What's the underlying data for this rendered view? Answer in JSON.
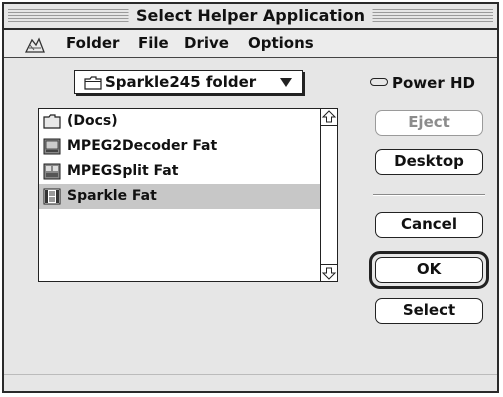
{
  "window": {
    "title": "Select Helper Application"
  },
  "menubar": {
    "logo_icon": "file-manager-logo-icon",
    "items": [
      "Folder",
      "File",
      "Drive",
      "Options"
    ]
  },
  "folder_popup": {
    "icon": "folder-icon",
    "label": "Sparkle245 folder"
  },
  "file_list": {
    "items": [
      {
        "label": "(Docs)",
        "icon": "folder-icon",
        "selected": false
      },
      {
        "label": "MPEG2Decoder Fat",
        "icon": "application-icon",
        "selected": false
      },
      {
        "label": "MPEGSplit Fat",
        "icon": "application-icon",
        "selected": false
      },
      {
        "label": "Sparkle Fat",
        "icon": "film-application-icon",
        "selected": true
      }
    ]
  },
  "volume": {
    "icon": "hard-disk-icon",
    "label": "Power HD"
  },
  "buttons": {
    "eject": "Eject",
    "desktop": "Desktop",
    "cancel": "Cancel",
    "ok": "OK",
    "select": "Select"
  },
  "colors": {
    "selection": "#c7c7c7",
    "window_bg": "#e6e6e6",
    "frame": "#2a2a2a",
    "disabled_text": "#8c8c8c"
  }
}
